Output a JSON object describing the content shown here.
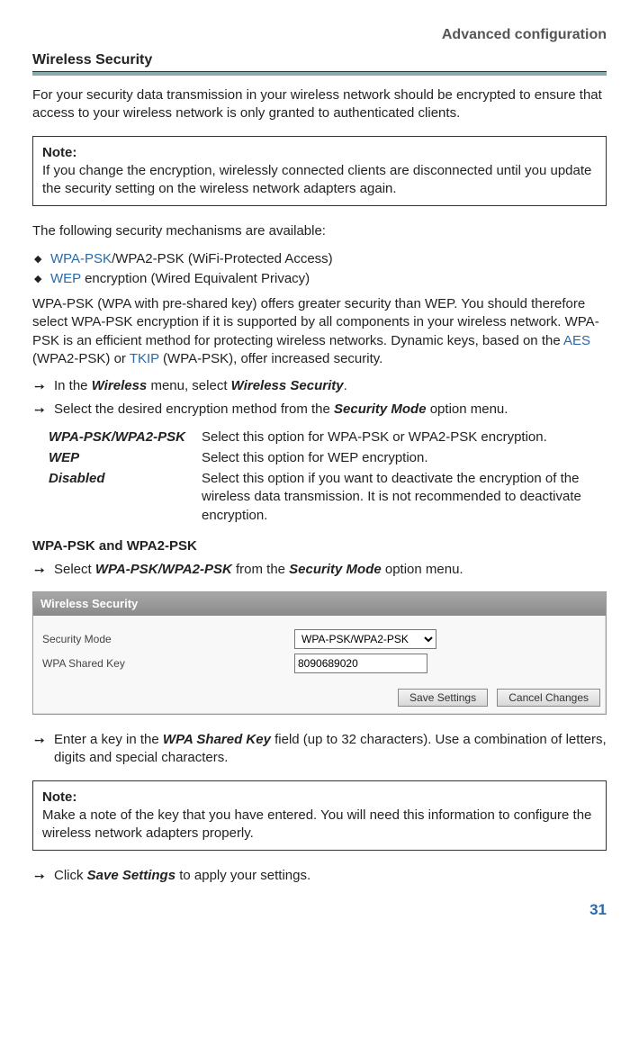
{
  "header": {
    "chapter": "Advanced configuration"
  },
  "section": {
    "title": "Wireless Security"
  },
  "intro": "For your security data transmission in your wireless network should be encrypted to ensure that access to your wireless network is only granted to authenticated clients.",
  "note1": {
    "label": "Note:",
    "body": "If you change the encryption, wirelessly connected clients are disconnected until you update the security setting on the wireless network adapters again."
  },
  "avail_line": "The following security mechanisms are available:",
  "mech": {
    "item1_link": "WPA-PSK",
    "item1_rest": "/WPA2-PSK (WiFi-Protected Access)",
    "item2_link": "WEP",
    "item2_rest": " encryption (Wired Equivalent Privacy)"
  },
  "wpa_para_a": "WPA-PSK (WPA with pre-shared key) offers greater security than WEP. You should therefore select WPA-PSK encryption if it is supported by all components in your wireless network. WPA-PSK is an efficient method for protecting wireless networks. Dynamic keys, based on the ",
  "wpa_aes": "AES",
  "wpa_para_b": " (WPA2-PSK) or ",
  "wpa_tkip": "TKIP",
  "wpa_para_c": " (WPA-PSK), offer increased security.",
  "step1": {
    "a": "In the ",
    "b": "Wireless",
    "c": " menu, select ",
    "d": "Wireless Security",
    "e": "."
  },
  "step2": {
    "a": "Select the desired encryption method from the ",
    "b": "Security Mode",
    "c": " option menu."
  },
  "options": [
    {
      "name": "WPA-PSK/WPA2-PSK",
      "desc": "Select this option for WPA-PSK or WPA2-PSK encryption."
    },
    {
      "name": "WEP",
      "desc": "Select this option for WEP encryption."
    },
    {
      "name": "Disabled",
      "desc": "Select this option if you want to deactivate the encryption of the wireless data transmission. It is not recommended to deactivate encryption."
    }
  ],
  "subhead": "WPA-PSK and WPA2-PSK",
  "step3": {
    "a": "Select ",
    "b": "WPA-PSK/WPA2-PSK",
    "c": " from the ",
    "d": "Security Mode",
    "e": " option menu."
  },
  "panel": {
    "title": "Wireless Security",
    "label_mode": "Security Mode",
    "value_mode": "WPA-PSK/WPA2-PSK",
    "label_key": "WPA Shared Key",
    "value_key": "8090689020",
    "btn_save": "Save Settings",
    "btn_cancel": "Cancel Changes"
  },
  "step4": {
    "a": "Enter a key in the ",
    "b": "WPA Shared Key",
    "c": " field (up to 32 characters). Use a combination of letters, digits and special characters."
  },
  "note2": {
    "label": "Note:",
    "body": "Make a note of the key that you have entered. You will need this information to configure the wireless network adapters properly."
  },
  "step5": {
    "a": "Click ",
    "b": "Save Settings",
    "c": " to apply your settings."
  },
  "page_number": "31"
}
